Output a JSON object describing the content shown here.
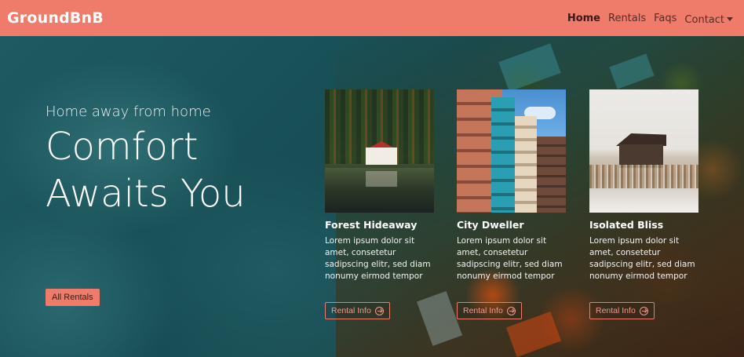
{
  "navbar": {
    "brand": "GroundBnB",
    "links": [
      {
        "label": "Home",
        "active": true
      },
      {
        "label": "Rentals",
        "active": false
      },
      {
        "label": "Faqs",
        "active": false
      },
      {
        "label": "Contact",
        "active": false
      }
    ]
  },
  "hero": {
    "subtitle": "Home away from home",
    "headline": "Comfort Awaits You",
    "cta_label": "All Rentals"
  },
  "cards": [
    {
      "title": "Forest Hideaway",
      "text": "Lorem ipsum dolor sit amet, consetetur sadipscing elitr, sed diam nonumy eirmod tempor",
      "button_label": "Rental Info",
      "image": "forest-lake-house"
    },
    {
      "title": "City Dweller",
      "text": "Lorem ipsum dolor sit amet, consetetur sadipscing elitr, sed diam nonumy eirmod tempor",
      "button_label": "Rental Info",
      "image": "colorful-city-buildings"
    },
    {
      "title": "Isolated Bliss",
      "text": "Lorem ipsum dolor sit amet, consetetur sadipscing elitr, sed diam nonumy eirmod tempor",
      "button_label": "Rental Info",
      "image": "snowy-field-cabin"
    }
  ],
  "colors": {
    "accent": "#ef7b6b",
    "nav_text": "#5a2b25"
  },
  "icons": {
    "card_button": "arrow-right-circle-icon",
    "contact_dropdown": "caret-down-icon"
  }
}
